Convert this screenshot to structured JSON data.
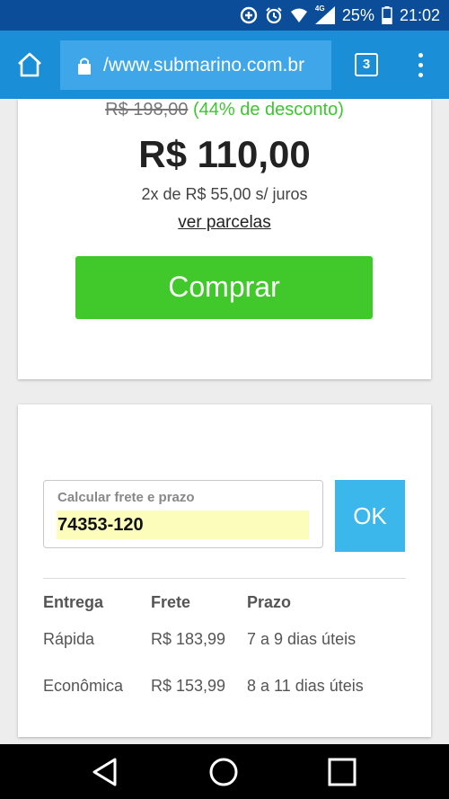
{
  "status_bar": {
    "battery": "25%",
    "network": "4G",
    "time": "21:02",
    "icons": [
      "data-saver-icon",
      "alarm-icon",
      "wifi-icon",
      "signal-icon",
      "battery-icon"
    ]
  },
  "browser": {
    "url": "/www.submarino.com.br",
    "tab_count": "3",
    "colors": {
      "status_bar": "#0b4d99",
      "toolbar": "#1a8fd8",
      "url_box": "#3fa7e9"
    }
  },
  "product": {
    "old_price": "R$ 198,00",
    "discount": "(44% de desconto)",
    "price": "R$ 110,00",
    "installments": "2x de R$ 55,00 s/ juros",
    "installments_link": "ver parcelas",
    "buy_label": "Comprar",
    "buy_color": "#41c92b",
    "discount_color": "#3ec631"
  },
  "freight": {
    "label": "Calcular frete e prazo",
    "cep_value": "74353-120",
    "ok_label": "OK",
    "ok_color": "#3bb7ec",
    "headers": {
      "entrega": "Entrega",
      "frete": "Frete",
      "prazo": "Prazo"
    },
    "rows": [
      {
        "entrega": "Rápida",
        "frete": "R$ 183,99",
        "prazo": "7 a 9 dias úteis"
      },
      {
        "entrega": "Econômica",
        "frete": "R$ 153,99",
        "prazo": "8 a 11 dias úteis"
      }
    ]
  },
  "nav": {
    "icons": [
      "back-icon",
      "home-circle-icon",
      "recents-icon"
    ]
  }
}
